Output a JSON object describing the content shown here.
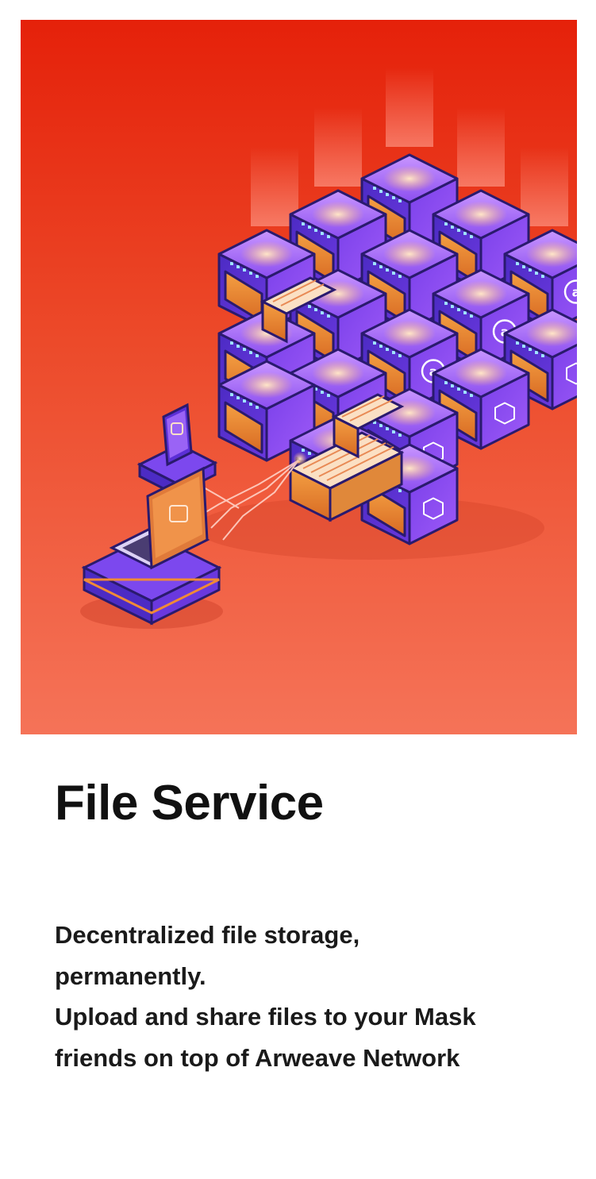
{
  "hero": {
    "image_description_icon": "file-storage-illustration",
    "background_top": "#e5210a",
    "background_bottom": "#f57358",
    "server_block_colors": [
      "#5b2fd6",
      "#8d4df2",
      "#f08a36"
    ],
    "server_emblem_label": "a"
  },
  "title": "File Service",
  "description": {
    "lines": [
      "Decentralized file storage,",
      "permanently.",
      "Upload and share files to your Mask",
      "friends on top of Arweave Network"
    ]
  }
}
